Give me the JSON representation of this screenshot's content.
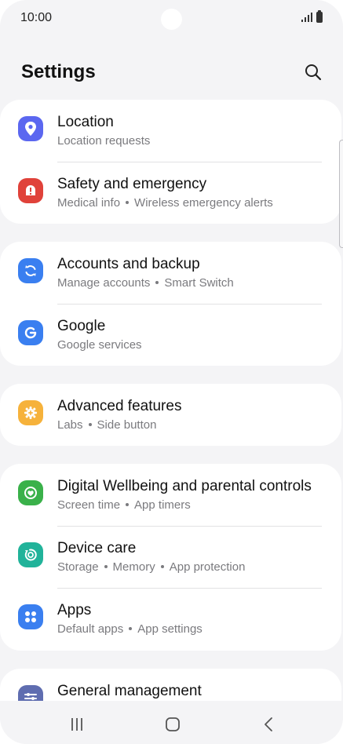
{
  "status_bar": {
    "time": "10:00"
  },
  "header": {
    "title": "Settings",
    "search_icon": "search-icon"
  },
  "colors": {
    "location": "#5b67f0",
    "safety": "#e0423a",
    "accounts": "#3a7ff0",
    "google": "#3a7ff0",
    "advanced": "#f6b23b",
    "wellbeing": "#3ab14a",
    "device_care": "#21b39a",
    "apps": "#3a7ff0",
    "general": "#5f6db0"
  },
  "groups": [
    {
      "items": [
        {
          "title": "Location",
          "subtitle": [
            "Location requests"
          ],
          "icon": "location-pin-icon"
        },
        {
          "title": "Safety and emergency",
          "subtitle": [
            "Medical info",
            "Wireless emergency alerts"
          ],
          "icon": "alert-icon"
        }
      ]
    },
    {
      "items": [
        {
          "title": "Accounts and backup",
          "subtitle": [
            "Manage accounts",
            "Smart Switch"
          ],
          "icon": "sync-icon"
        },
        {
          "title": "Google",
          "subtitle": [
            "Google services"
          ],
          "icon": "google-icon"
        }
      ]
    },
    {
      "items": [
        {
          "title": "Advanced features",
          "subtitle": [
            "Labs",
            "Side button"
          ],
          "icon": "gear-plus-icon"
        }
      ]
    },
    {
      "items": [
        {
          "title": "Digital Wellbeing and parental controls",
          "subtitle": [
            "Screen time",
            "App timers"
          ],
          "icon": "wellbeing-icon"
        },
        {
          "title": "Device care",
          "subtitle": [
            "Storage",
            "Memory",
            "App protection"
          ],
          "icon": "device-care-icon"
        },
        {
          "title": "Apps",
          "subtitle": [
            "Default apps",
            "App settings"
          ],
          "icon": "apps-grid-icon"
        }
      ]
    },
    {
      "items": [
        {
          "title": "General management",
          "subtitle": [],
          "icon": "sliders-icon"
        }
      ]
    }
  ],
  "nav": {
    "recents_icon": "recents-icon",
    "home_icon": "home-icon",
    "back_icon": "back-icon"
  }
}
